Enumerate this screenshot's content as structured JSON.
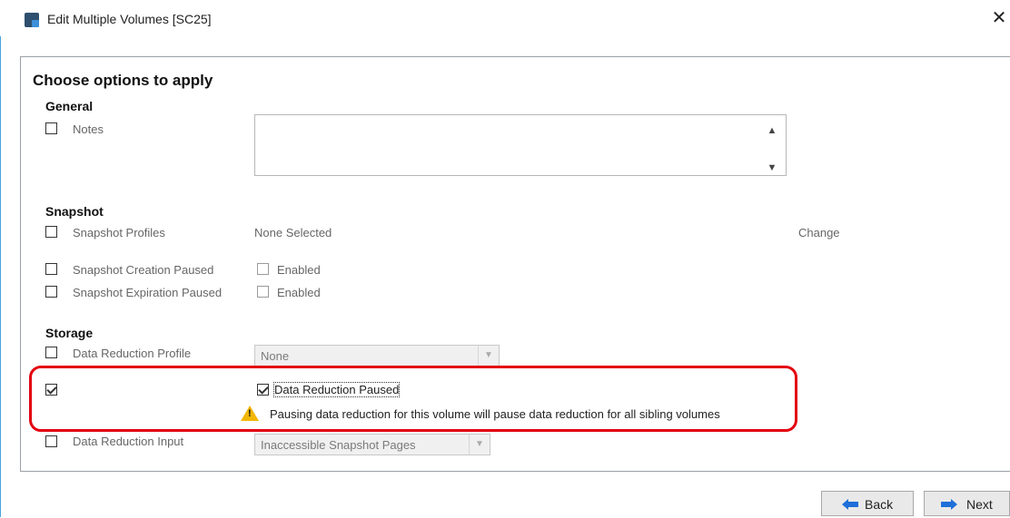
{
  "window": {
    "title": "Edit Multiple Volumes  [SC25]",
    "close_glyph": "✕"
  },
  "main": {
    "heading": "Choose options to apply"
  },
  "general": {
    "heading": "General",
    "notes_label": "Notes",
    "notes_value": ""
  },
  "snapshot": {
    "heading": "Snapshot",
    "profiles_label": "Snapshot Profiles",
    "profiles_value": "None Selected",
    "change_link": "Change",
    "creation_paused_label": "Snapshot Creation Paused",
    "creation_paused_value": "Enabled",
    "expiration_paused_label": "Snapshot Expiration Paused",
    "expiration_paused_value": "Enabled"
  },
  "storage": {
    "heading": "Storage",
    "reduction_profile_label": "Data Reduction Profile",
    "reduction_profile_value": "None",
    "reduction_paused_label": "Data Reduction Paused",
    "reduction_paused_checked": true,
    "warning_text": "Pausing data reduction for this volume will pause data reduction for all sibling volumes",
    "reduction_input_label": "Data Reduction Input",
    "reduction_input_value": "Inaccessible Snapshot Pages"
  },
  "footer": {
    "back_label": "Back",
    "next_label": "Next"
  },
  "colors": {
    "accent_border": "#4aa3df",
    "highlight": "#e3000f",
    "warning": "#f2b705",
    "arrow_blue": "#1e6fd9"
  },
  "icons": [
    "app-icon",
    "close-icon",
    "scroll-up-icon",
    "scroll-down-icon",
    "chevron-down-icon",
    "warning-icon",
    "arrow-left-icon",
    "arrow-right-icon"
  ]
}
